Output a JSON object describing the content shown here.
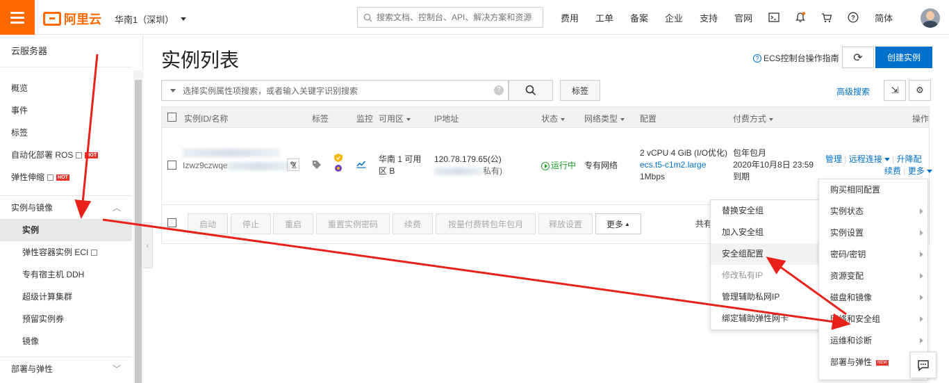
{
  "header": {
    "logo_text": "阿里云",
    "region": "华南1（深圳）",
    "search_placeholder": "搜索文档、控制台、API、解决方案和资源",
    "nav": [
      "费用",
      "工单",
      "备案",
      "企业",
      "支持",
      "官网"
    ],
    "lang": "简体"
  },
  "sidebar": {
    "title": "云服务器",
    "items": [
      {
        "label": "概览"
      },
      {
        "label": "事件"
      },
      {
        "label": "标签"
      },
      {
        "label": "自动化部署 ROS",
        "badge": "HOT"
      },
      {
        "label": "弹性伸缩",
        "badge": "HOT"
      }
    ],
    "group1": "实例与镜像",
    "group1_items": [
      {
        "label": "实例"
      },
      {
        "label": "弹性容器实例 ECI"
      },
      {
        "label": "专有宿主机 DDH"
      },
      {
        "label": "超级计算集群"
      },
      {
        "label": "预留实例券"
      },
      {
        "label": "镜像"
      }
    ],
    "group2": "部署与弹性"
  },
  "main": {
    "title": "实例列表",
    "help": "ECS控制台操作指南",
    "create": "创建实例",
    "filter_placeholder": "选择实例属性项搜索，或者输入关键字识别搜索",
    "tag_button": "标签",
    "advanced_search": "高级搜索"
  },
  "table": {
    "headers": {
      "id": "实例ID/名称",
      "tag": "标签",
      "monitor": "监控",
      "zone": "可用区",
      "ip": "IP地址",
      "status": "状态",
      "net": "网络类型",
      "config": "配置",
      "pay": "付费方式",
      "ops": "操作"
    },
    "row": {
      "id_tail": "Z",
      "id_partial": "Izwz9czwqe",
      "zone": [
        "华南 1 可用",
        "区 B"
      ],
      "ip_public": "120.78.179.65(公)",
      "ip_private_tail": "私有)",
      "status": "运行中",
      "net": "专有网络",
      "config_cpu": "2 vCPU 4 GiB (I/O优化)",
      "config_type": "ecs.t5-c1m2.large",
      "config_bw": "1Mbps",
      "pay_type": "包年包月",
      "pay_expire": "2020年10月8日 23:59",
      "pay_end": "到期",
      "op_manage": "管理",
      "op_remote": "远程连接",
      "op_resize": "升降配",
      "op_renew": "续费",
      "op_more": "更多"
    },
    "batch": [
      "启动",
      "停止",
      "重启",
      "重置实例密码",
      "续费",
      "按量付费转包年包月",
      "释放设置",
      "更多"
    ],
    "total": "共有"
  },
  "more_menu": {
    "items": [
      {
        "label": "购买相同配置",
        "arrow": false
      },
      {
        "label": "实例状态",
        "arrow": true
      },
      {
        "label": "实例设置",
        "arrow": true
      },
      {
        "label": "密码/密钥",
        "arrow": true
      },
      {
        "label": "资源变配",
        "arrow": true
      },
      {
        "label": "磁盘和镜像",
        "arrow": true
      },
      {
        "label": "网络和安全组",
        "arrow": true
      },
      {
        "label": "运维和诊断",
        "arrow": true
      },
      {
        "label": "部署与弹性",
        "arrow": false,
        "badge": "NEW"
      }
    ]
  },
  "sub_menu": {
    "items": [
      {
        "label": "替换安全组"
      },
      {
        "label": "加入安全组"
      },
      {
        "label": "安全组配置"
      },
      {
        "label": "修改私有IP"
      },
      {
        "label": "管理辅助私网IP"
      },
      {
        "label": "绑定辅助弹性网卡"
      }
    ]
  },
  "colors": {
    "brand": "#ff6a00",
    "link": "#0070cc",
    "annotation": "#e8221b",
    "running": "#1a9f29"
  }
}
